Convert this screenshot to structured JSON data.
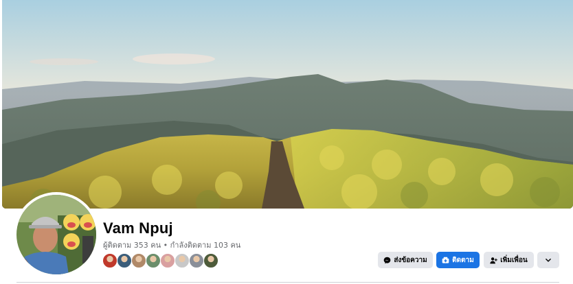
{
  "profile": {
    "name": "Vam Npuj",
    "stats": "ผู้ติดตาม 353 คน • กำลังติดตาม 103 คน"
  },
  "friends": {
    "count_shown": 8,
    "colors": [
      "#c0392b",
      "#3b5d7a",
      "#b08968",
      "#6b8e6b",
      "#d9a0a0",
      "#c8c8c8",
      "#8a8f99",
      "#4d5b3a"
    ]
  },
  "actions": {
    "message_label": "ส่งข้อความ",
    "follow_label": "ติดตาม",
    "add_friend_label": "เพิ่มเพื่อน"
  },
  "icons": {
    "message": "messenger-icon",
    "follow": "follow-icon",
    "add_friend": "add-friend-icon",
    "more": "chevron-down-icon"
  },
  "theme": {
    "primary": "#1b74e4",
    "secondary_button": "#e4e6eb",
    "text_secondary": "#65676b"
  }
}
